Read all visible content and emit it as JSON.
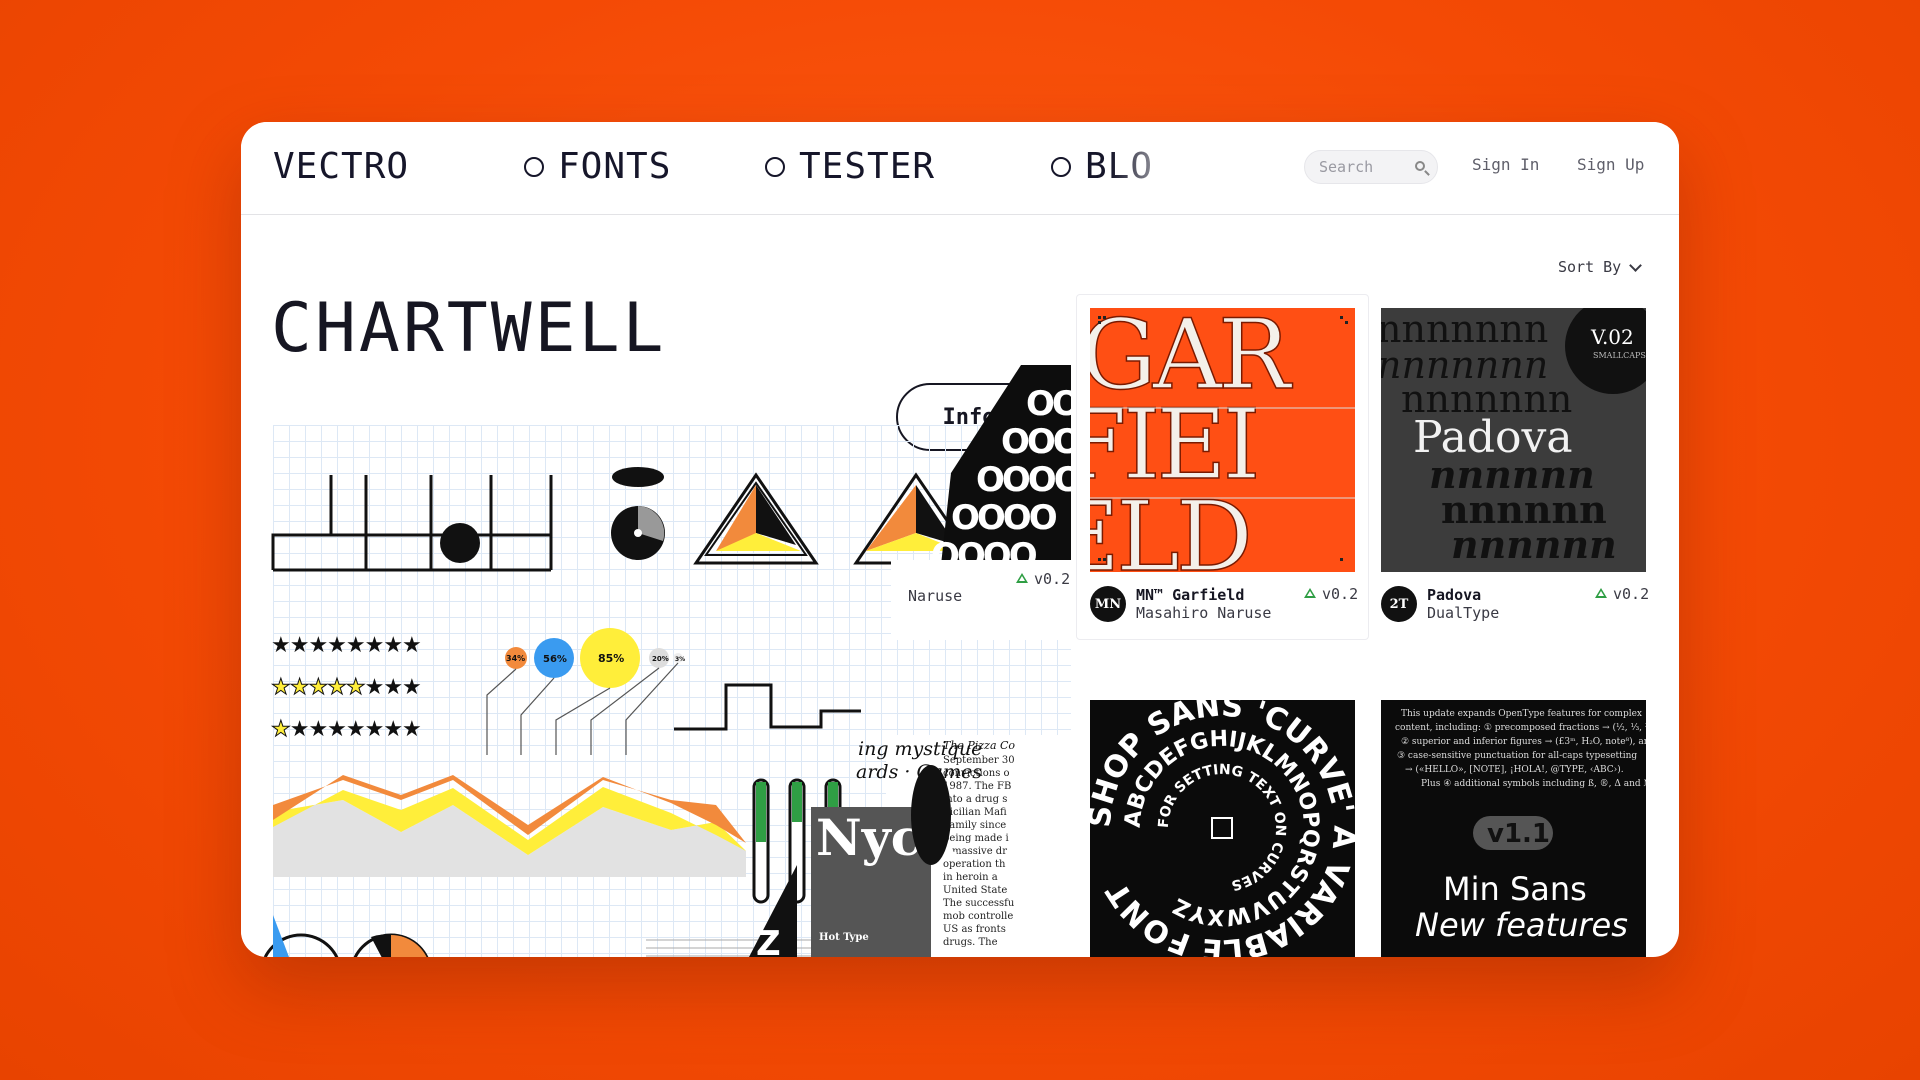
{
  "header": {
    "logo": "VECTRO",
    "nav": [
      {
        "label": "FONTS"
      },
      {
        "label": "TESTER"
      },
      {
        "label": "BLO"
      }
    ],
    "search_placeholder": "Search",
    "sign_in": "Sign In",
    "sign_up": "Sign Up"
  },
  "detail": {
    "title": "CHARTWELL",
    "info_button": "Info"
  },
  "sort_label": "Sort By",
  "cards": [
    {
      "name": "",
      "author": "Naruse",
      "version": "v0.2"
    },
    {
      "name": "MN™ Garfield",
      "author": "Masahiro Naruse",
      "version": "v0.2",
      "avatar": "MN"
    },
    {
      "name": "Padova",
      "author": "DualType",
      "version": "v0.2",
      "avatar": "2T"
    }
  ],
  "artwork": {
    "padova_badge": "V.02",
    "padova_badge_sub": "SMALLCAPS",
    "padova_word": "Padova",
    "garfield_letters": "GAR FIEL ELD",
    "curve_text": "SHOP SANS 'CURVE' A VARIABLE FONT",
    "minsans_title": "Min Sans",
    "minsans_sub": "New features",
    "minsans_version": "v1.1",
    "nyck_word": "Nyck",
    "hot_type": "Hot Type",
    "mystique": "ing mystique",
    "cards_games": "ards · Games",
    "pizza_head": "The Pizza Co",
    "chart_pcts": [
      "34%",
      "56%",
      "85%",
      "20%",
      "3%"
    ]
  },
  "colors": {
    "brand_orange": "#ff4d0a",
    "card_orange": "#ff4f14",
    "accent_yellow": "#ffee3a",
    "accent_blue": "#3a9bf0",
    "accent_green": "#2f9e44"
  }
}
